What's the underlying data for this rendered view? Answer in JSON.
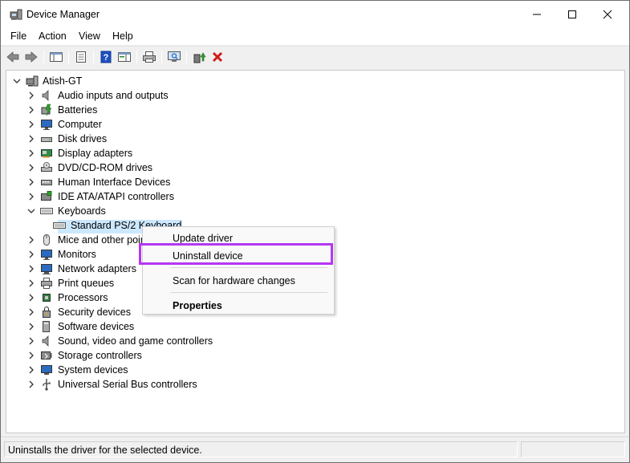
{
  "window": {
    "title": "Device Manager"
  },
  "menu": [
    "File",
    "Action",
    "View",
    "Help"
  ],
  "tree": {
    "root": "Atish-GT",
    "categories": [
      {
        "label": "Audio inputs and outputs",
        "icon": "speaker-icon"
      },
      {
        "label": "Batteries",
        "icon": "battery-icon"
      },
      {
        "label": "Computer",
        "icon": "monitor-icon"
      },
      {
        "label": "Disk drives",
        "icon": "disk-drive-icon"
      },
      {
        "label": "Display adapters",
        "icon": "display-adapter-icon"
      },
      {
        "label": "DVD/CD-ROM drives",
        "icon": "dvd-drive-icon"
      },
      {
        "label": "Human Interface Devices",
        "icon": "hid-icon"
      },
      {
        "label": "IDE ATA/ATAPI controllers",
        "icon": "ide-controller-icon"
      },
      {
        "label": "Keyboards",
        "icon": "keyboard-icon",
        "expanded": true
      },
      {
        "label": "Standard PS/2 Keyboard",
        "icon": "keyboard-icon",
        "child": true,
        "selected": true
      },
      {
        "label": "Mice and other poir",
        "icon": "mouse-icon"
      },
      {
        "label": "Monitors",
        "icon": "monitor-icon"
      },
      {
        "label": "Network adapters",
        "icon": "network-adapter-icon"
      },
      {
        "label": "Print queues",
        "icon": "printer-icon"
      },
      {
        "label": "Processors",
        "icon": "processor-icon"
      },
      {
        "label": "Security devices",
        "icon": "security-device-icon"
      },
      {
        "label": "Software devices",
        "icon": "software-device-icon"
      },
      {
        "label": "Sound, video and game controllers",
        "icon": "speaker-icon"
      },
      {
        "label": "Storage controllers",
        "icon": "storage-controller-icon"
      },
      {
        "label": "System devices",
        "icon": "system-device-icon"
      },
      {
        "label": "Universal Serial Bus controllers",
        "icon": "usb-icon"
      }
    ]
  },
  "context_menu": {
    "items": [
      "Update driver",
      "Uninstall device",
      "Scan for hardware changes",
      "Properties"
    ],
    "highlighted": "Uninstall device",
    "highlight_color": "#b537f2"
  },
  "status": {
    "text": "Uninstalls the driver for the selected device."
  },
  "colors": {
    "selection": "#cce8ff",
    "uninstall_x": "#d11c1c",
    "help_blue": "#1f4fc2"
  }
}
